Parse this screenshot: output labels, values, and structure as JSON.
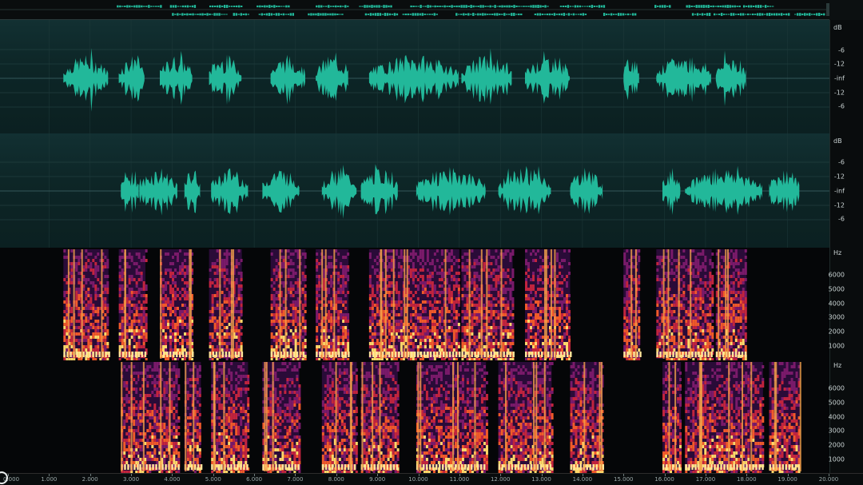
{
  "colors": {
    "waveform": "#22b89a",
    "background": "#0c1011",
    "spectrum_hot": "#ffe49a",
    "spectrum_mid": "#d8392a",
    "spectrum_low": "#5a1a6a"
  },
  "overview": {
    "label": ""
  },
  "rulers": {
    "db_unit": "dB",
    "db_labels": [
      "-6",
      "-12",
      "-inf",
      "-12",
      "-6"
    ],
    "hz_unit": "Hz",
    "hz_labels": [
      "6000",
      "5000",
      "4000",
      "3000",
      "2000",
      "1000"
    ]
  },
  "timeline": {
    "labels": [
      "0.000",
      "1.000",
      "2.000",
      "3.000",
      "4.000",
      "5.000",
      "6.000",
      "7.000",
      "8.000",
      "9.000",
      "10.000",
      "11.000",
      "12.000",
      "13.000",
      "14.000",
      "15.000",
      "16.000",
      "17.000",
      "18.000",
      "19.000",
      "20.000"
    ]
  },
  "tracks": [
    {
      "segments_seconds": [
        [
          1.35,
          2.45
        ],
        [
          2.7,
          3.35
        ],
        [
          3.7,
          4.5
        ],
        [
          4.9,
          5.7
        ],
        [
          6.4,
          7.25
        ],
        [
          7.5,
          8.3
        ],
        [
          8.8,
          11.0
        ],
        [
          11.05,
          12.3
        ],
        [
          12.6,
          13.7
        ],
        [
          15.0,
          15.4
        ],
        [
          15.8,
          17.15
        ],
        [
          17.25,
          18.0
        ]
      ]
    },
    {
      "segments_seconds": [
        [
          2.75,
          3.2
        ],
        [
          3.2,
          4.15
        ],
        [
          4.3,
          4.7
        ],
        [
          4.95,
          5.85
        ],
        [
          6.2,
          7.1
        ],
        [
          7.65,
          8.5
        ],
        [
          8.6,
          9.5
        ],
        [
          9.95,
          11.65
        ],
        [
          11.95,
          13.25
        ],
        [
          13.7,
          14.5
        ],
        [
          15.95,
          16.4
        ],
        [
          16.5,
          18.4
        ],
        [
          18.55,
          19.3
        ]
      ]
    }
  ]
}
